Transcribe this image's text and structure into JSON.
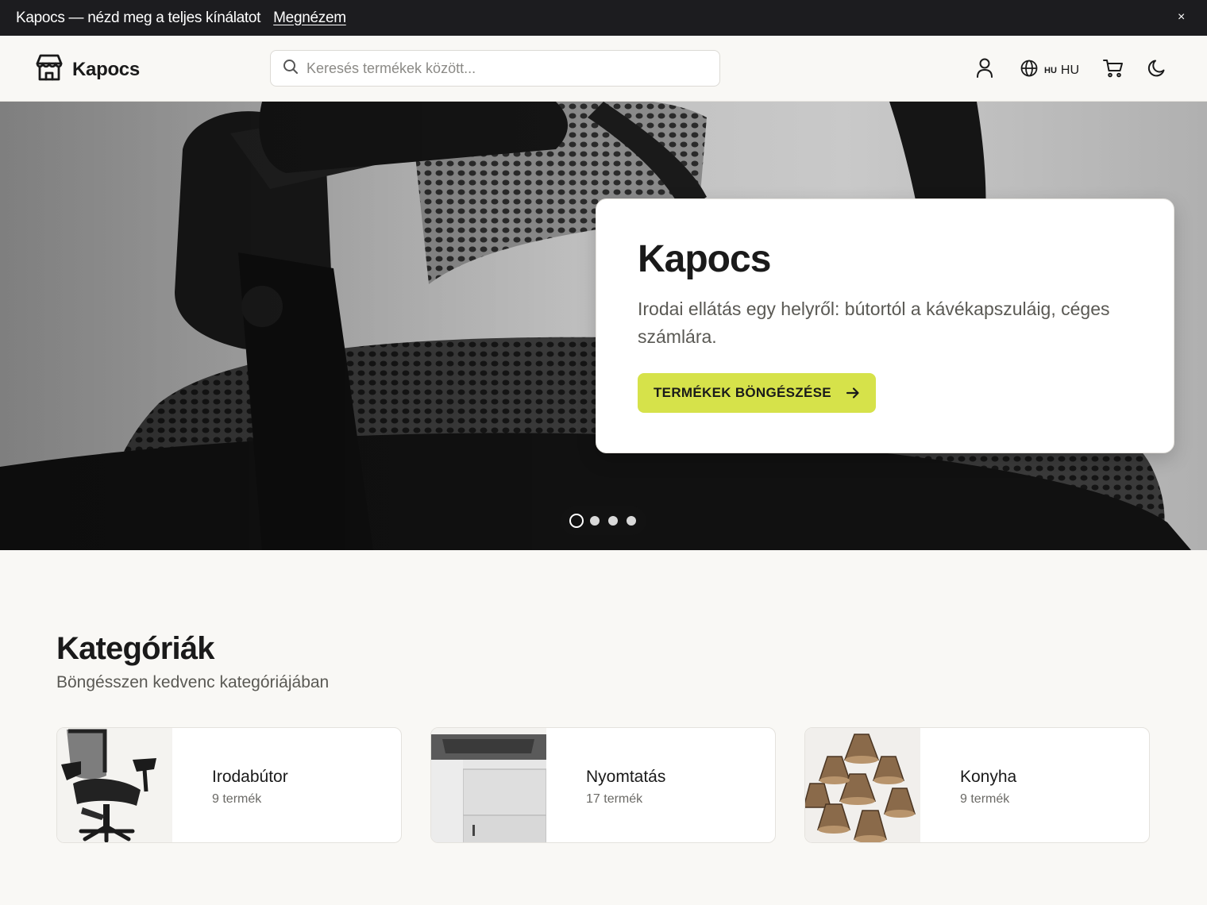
{
  "announcement": {
    "text": "Kapocs — nézd meg a teljes kínálatot",
    "link": "Megnézem",
    "close": "×"
  },
  "header": {
    "brand": "Kapocs",
    "search_placeholder": "Keresés termékek között...",
    "language_flag": "HU",
    "language_code": "HU",
    "icons": [
      "store-icon",
      "search-icon",
      "user-icon",
      "globe-icon",
      "cart-icon",
      "moon-icon"
    ]
  },
  "hero": {
    "title": "Kapocs",
    "subtitle": "Irodai ellátás egy helyről: bútortól a kávékapszuláig, céges számlára.",
    "cta_label": "TERMÉKEK BÖNGÉSZÉSE",
    "slides_total": 4,
    "active_slide": 1
  },
  "categories": {
    "title": "Kategóriák",
    "subtitle": "Böngésszen kedvenc kategóriájában",
    "items": [
      {
        "name": "Irodabútor",
        "count": "9 termék"
      },
      {
        "name": "Nyomtatás",
        "count": "17 termék"
      },
      {
        "name": "Konyha",
        "count": "9 termék"
      }
    ]
  },
  "colors": {
    "accent": "#d6e24a",
    "topbar": "#1c1c1f",
    "page_bg": "#f9f8f5"
  }
}
